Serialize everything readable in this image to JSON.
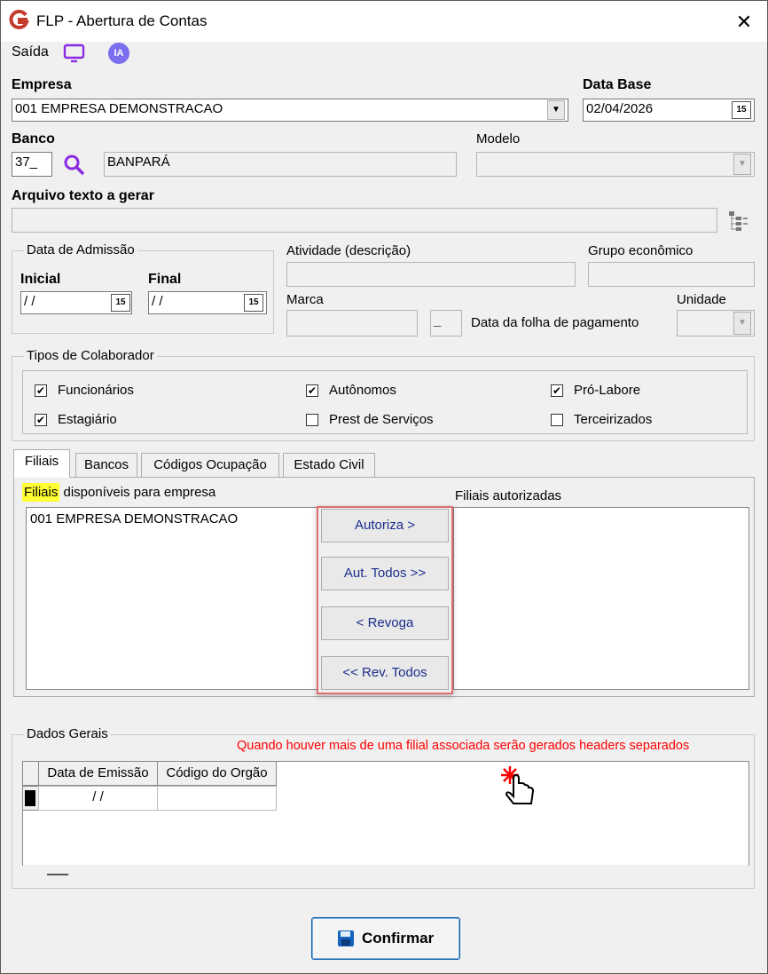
{
  "window": {
    "title": "FLP - Abertura de Contas",
    "close": "✕",
    "accent": "#c43b2e"
  },
  "toolbar": {
    "exit_label": "Saída",
    "ai_label": "IA"
  },
  "empresa": {
    "label": "Empresa",
    "value": "001 EMPRESA DEMONSTRACAO"
  },
  "data_base": {
    "label": "Data Base",
    "value": "02/04/2026"
  },
  "banco": {
    "label": "Banco",
    "code": "37_",
    "name": "BANPARÁ"
  },
  "modelo": {
    "label": "Modelo",
    "value": ""
  },
  "arquivo": {
    "label": "Arquivo texto a gerar",
    "value": ""
  },
  "admissao": {
    "group_label": "Data de Admissão",
    "inicial_label": "Inicial",
    "inicial_value": " /  /",
    "final_label": "Final",
    "final_value": " /  /"
  },
  "atividade": {
    "label": "Atividade (descrição)",
    "value": ""
  },
  "grupo": {
    "label": "Grupo econômico",
    "value": ""
  },
  "marca": {
    "label": "Marca",
    "value": ""
  },
  "folha": {
    "label": "Data da folha de pagamento"
  },
  "unidade": {
    "label": "Unidade",
    "value": ""
  },
  "calendar_glyph": "15",
  "tipos": {
    "group_label": "Tipos de Colaborador",
    "items": [
      {
        "label": "Funcionários",
        "checked": true
      },
      {
        "label": "Autônomos",
        "checked": true
      },
      {
        "label": "Pró-Labore",
        "checked": true
      },
      {
        "label": "Estagiário",
        "checked": true
      },
      {
        "label": "Prest de Serviços",
        "checked": false
      },
      {
        "label": "Terceirizados",
        "checked": false
      }
    ]
  },
  "tabs": [
    {
      "label": "Filiais",
      "active": true
    },
    {
      "label": "Bancos",
      "active": false
    },
    {
      "label": "Códigos Ocupação",
      "active": false
    },
    {
      "label": "Estado Civil",
      "active": false
    }
  ],
  "filiais": {
    "available_highlight": "Filiais",
    "available_rest": " disponíveis para empresa",
    "authorized_label": "Filiais autorizadas",
    "available_items": [
      "001 EMPRESA DEMONSTRACAO"
    ],
    "buttons": [
      "Autoriza >",
      "Aut. Todos >>",
      "< Revoga",
      "<< Rev. Todos"
    ]
  },
  "dados": {
    "group_label": "Dados Gerais",
    "warning": "Quando houver mais de uma filial associada serão gerados headers separados",
    "columns": [
      "Data de Emissão",
      "Código do Orgão"
    ],
    "row": [
      " /  /",
      ""
    ]
  },
  "confirm_label": "Confirmar",
  "colors": {
    "highlight": "#ffff33",
    "red_frame": "#e07070",
    "warning": "#ff0000",
    "button_text": "#1c2e8c"
  }
}
